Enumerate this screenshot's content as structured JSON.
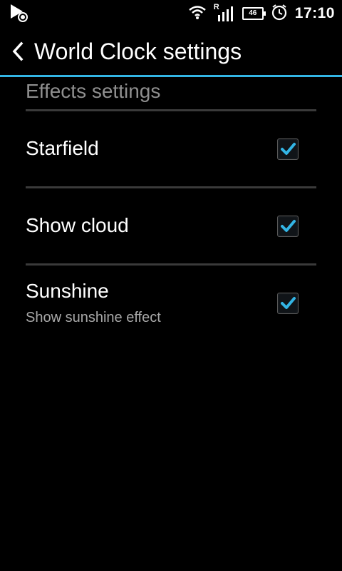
{
  "status_bar": {
    "time": "17:10",
    "battery_text": "46",
    "signal_label": "R",
    "icons": [
      "play-store-notification-icon",
      "wifi-icon",
      "signal-icon",
      "battery-icon",
      "alarm-icon"
    ]
  },
  "action_bar": {
    "title": "World Clock settings",
    "back_icon": "chevron-left-icon"
  },
  "colors": {
    "accent": "#33b5e5",
    "background": "#000000",
    "category_text": "#8f8f8f",
    "summary_text": "#a8a8a8",
    "divider": "#3a3a3a"
  },
  "category": {
    "title": "Effects settings"
  },
  "preferences": [
    {
      "title": "Starfield",
      "summary": "",
      "checked": true
    },
    {
      "title": "Show cloud",
      "summary": "",
      "checked": true
    },
    {
      "title": "Sunshine",
      "summary": "Show sunshine effect",
      "checked": true
    }
  ]
}
